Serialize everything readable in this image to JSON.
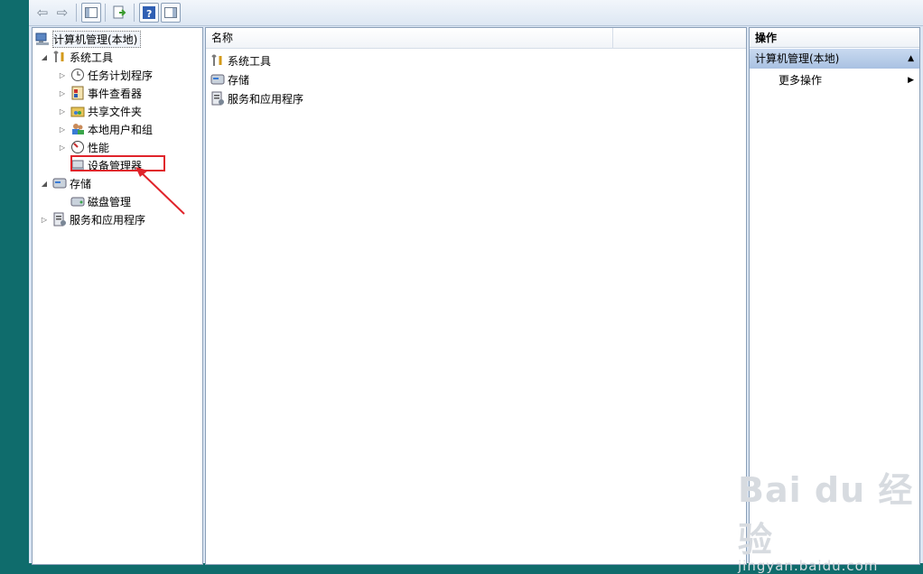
{
  "tree": {
    "root": "计算机管理(本地)",
    "items": [
      {
        "label": "系统工具",
        "icon": "tools-icon",
        "expander": "◢"
      },
      {
        "label": "任务计划程序",
        "icon": "clock-icon",
        "expander": "▷"
      },
      {
        "label": "事件查看器",
        "icon": "event-viewer-icon",
        "expander": "▷"
      },
      {
        "label": "共享文件夹",
        "icon": "shared-folder-icon",
        "expander": "▷"
      },
      {
        "label": "本地用户和组",
        "icon": "users-icon",
        "expander": "▷"
      },
      {
        "label": "性能",
        "icon": "performance-icon",
        "expander": "▷"
      },
      {
        "label": "设备管理器",
        "icon": "device-manager-icon",
        "expander": ""
      },
      {
        "label": "存储",
        "icon": "storage-icon",
        "expander": "◢"
      },
      {
        "label": "磁盘管理",
        "icon": "disk-icon",
        "expander": ""
      },
      {
        "label": "服务和应用程序",
        "icon": "services-icon",
        "expander": "▷"
      }
    ]
  },
  "list": {
    "column_name": "名称",
    "rows": [
      {
        "label": "系统工具",
        "icon": "tools-icon"
      },
      {
        "label": "存储",
        "icon": "storage-icon"
      },
      {
        "label": "服务和应用程序",
        "icon": "services-icon"
      }
    ]
  },
  "actions": {
    "header": "操作",
    "section": "计算机管理(本地)",
    "item": "更多操作"
  },
  "watermark": {
    "logo": "Bai du 经验",
    "url": "jingyan.baidu.com"
  },
  "colors": {
    "highlight": "#e0242b",
    "section_bg": "#a9c1e2",
    "desktop": "#0f6c6c"
  }
}
